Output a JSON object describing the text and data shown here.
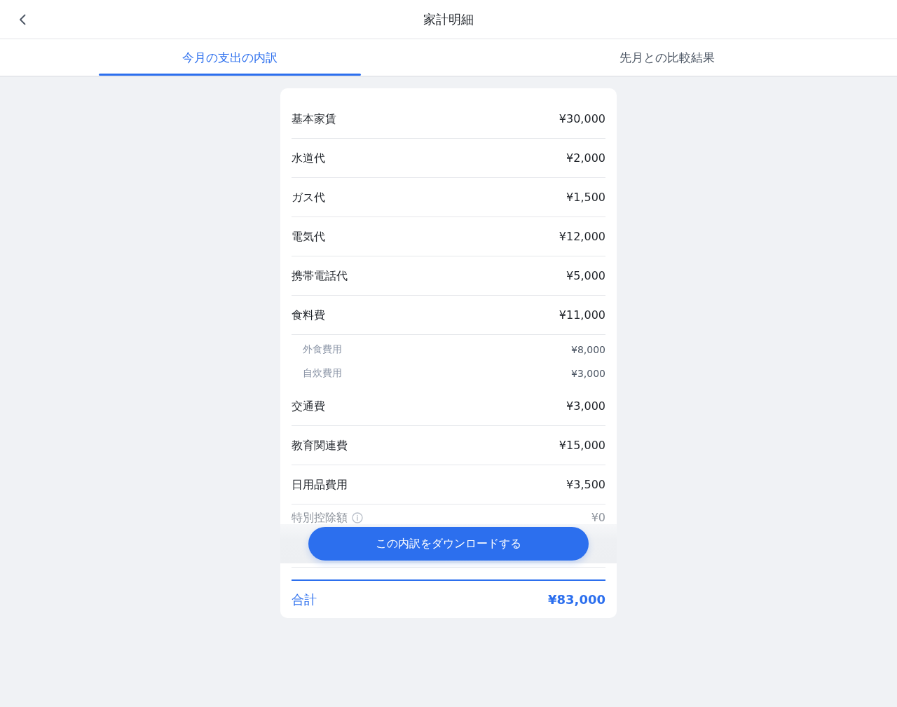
{
  "header": {
    "title": "家計明細"
  },
  "tabs": [
    {
      "label": "今月の支出の内訳",
      "selected": true
    },
    {
      "label": "先月との比較結果",
      "selected": false
    }
  ],
  "items": [
    {
      "label": "基本家賃",
      "amount": "¥30,000",
      "info": false
    },
    {
      "label": "水道代",
      "amount": "¥2,000",
      "info": false
    },
    {
      "label": "ガス代",
      "amount": "¥1,500",
      "info": false
    },
    {
      "label": "電気代",
      "amount": "¥12,000",
      "info": false
    },
    {
      "label": "携帯電話代",
      "amount": "¥5,000",
      "info": false
    },
    {
      "label": "食料費",
      "amount": "¥11,000",
      "info": false,
      "children": [
        {
          "label": "外食費用",
          "amount": "¥8,000"
        },
        {
          "label": "自炊費用",
          "amount": "¥3,000"
        }
      ]
    },
    {
      "label": "交通費",
      "amount": "¥3,000",
      "info": false
    },
    {
      "label": "教育関連費",
      "amount": "¥15,000",
      "info": false
    },
    {
      "label": "日用品費用",
      "amount": "¥3,500",
      "info": false
    },
    {
      "label": "特別控除額",
      "amount": "¥0",
      "info": true
    }
  ],
  "total": {
    "label": "合計",
    "amount": "¥83,000"
  },
  "action_button": {
    "label": "この内訳をダウンロードする"
  }
}
